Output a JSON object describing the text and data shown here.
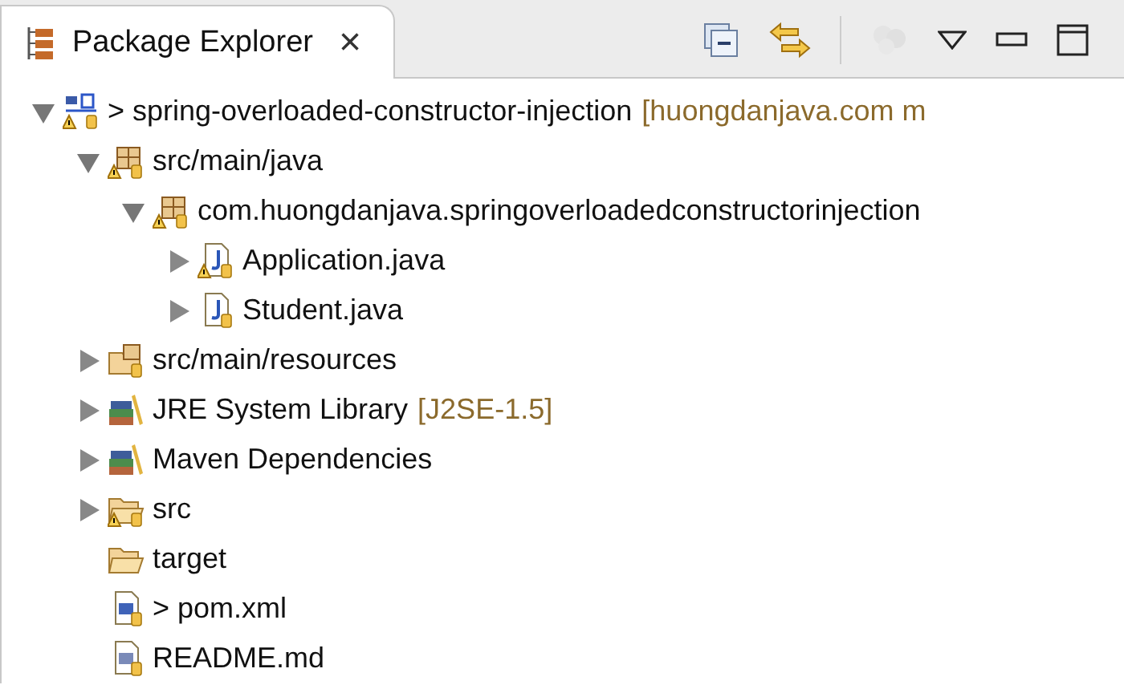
{
  "view": {
    "title": "Package Explorer",
    "close": "×"
  },
  "tree": [
    {
      "kind": "maven-project",
      "label": "> spring-overloaded-constructor-injection",
      "decoration": "[huongdanjava.com m",
      "warning": true,
      "expanded": true,
      "children": [
        {
          "kind": "package-root",
          "label": "src/main/java",
          "warning": true,
          "expanded": true,
          "children": [
            {
              "kind": "package",
              "label": "com.huongdanjava.springoverloadedconstructorinjection",
              "warning": true,
              "expanded": true,
              "children": [
                {
                  "kind": "java-file",
                  "label": "Application.java",
                  "warning": true,
                  "expanded": false
                },
                {
                  "kind": "java-file",
                  "label": "Student.java",
                  "warning": false,
                  "expanded": false
                }
              ]
            }
          ]
        },
        {
          "kind": "resource-folder",
          "label": "src/main/resources",
          "warning": false,
          "expanded": false
        },
        {
          "kind": "library",
          "label": "JRE System Library",
          "decoration": "[J2SE-1.5]",
          "warning": false,
          "expanded": false
        },
        {
          "kind": "library",
          "label": "Maven Dependencies",
          "warning": false,
          "expanded": false
        },
        {
          "kind": "folder",
          "label": "src",
          "warning": true,
          "expanded": false
        },
        {
          "kind": "open-folder",
          "label": "target",
          "warning": false
        },
        {
          "kind": "maven-file",
          "label": "> pom.xml",
          "warning": false
        },
        {
          "kind": "text-file",
          "label": "README.md",
          "warning": false
        }
      ]
    }
  ]
}
